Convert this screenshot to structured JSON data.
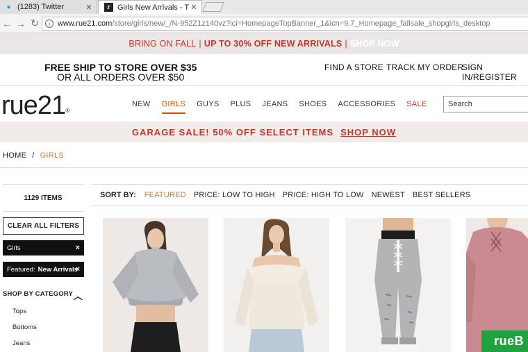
{
  "browser": {
    "tabs": [
      {
        "title": "(1283) Twitter",
        "icon": "twitter-icon"
      },
      {
        "title": "Girls New Arrivals - The",
        "icon": "rue21-favicon-icon"
      }
    ],
    "url_host": "www.rue21.com",
    "url_path": "/store/girls/new/_/N-952Z1z140vz?ici=HomepageTopBanner_1&icn=9.7_Homepage_fallsale_shopgirls_desktop"
  },
  "promo": {
    "lead": "BRING ON FALL",
    "offer": "UP TO 30% OFF NEW ARRIVALS",
    "cta": "SHOP NOW"
  },
  "utility": {
    "free_ship_line1": "FREE SHIP TO STORE OVER $35",
    "free_ship_line2": "OR ALL ORDERS OVER $50",
    "find_store": "FIND A STORE",
    "track_order": "TRACK MY ORDER",
    "sign_in": "SIGN IN/REGISTER"
  },
  "nav": {
    "logo": "rue21",
    "logo_mark": "®",
    "items": [
      "NEW",
      "GIRLS",
      "GUYS",
      "PLUS",
      "JEANS",
      "SHOES",
      "ACCESSORIES",
      "SALE"
    ],
    "search_placeholder": "Search"
  },
  "garage_banner": {
    "text": "GARAGE SALE! 50% OFF SELECT ITEMS",
    "cta": "SHOP NOW"
  },
  "breadcrumb": {
    "home": "HOME",
    "separator": "/",
    "current": "GIRLS"
  },
  "sidebar": {
    "item_count": "1129 ITEMS",
    "clear_filters": "CLEAR ALL FILTERS",
    "filter_girls": "Girls",
    "filter_featured_label": "Featured:",
    "filter_featured_value": "New Arrivals",
    "remove_icon": "×",
    "category_heading": "SHOP BY CATEGORY",
    "categories": [
      "Tops",
      "Bottoms",
      "Jeans"
    ]
  },
  "sort": {
    "label": "SORT BY:",
    "options": [
      "FEATURED",
      "PRICE: LOW TO HIGH",
      "PRICE: HIGH TO LOW",
      "NEWEST",
      "BEST SELLERS"
    ],
    "selected": "FEATURED"
  },
  "badge": {
    "text": "rueB"
  },
  "colors": {
    "accent": "#c0392b",
    "nav_active": "#d35400",
    "badge_green": "#1fa33f"
  }
}
